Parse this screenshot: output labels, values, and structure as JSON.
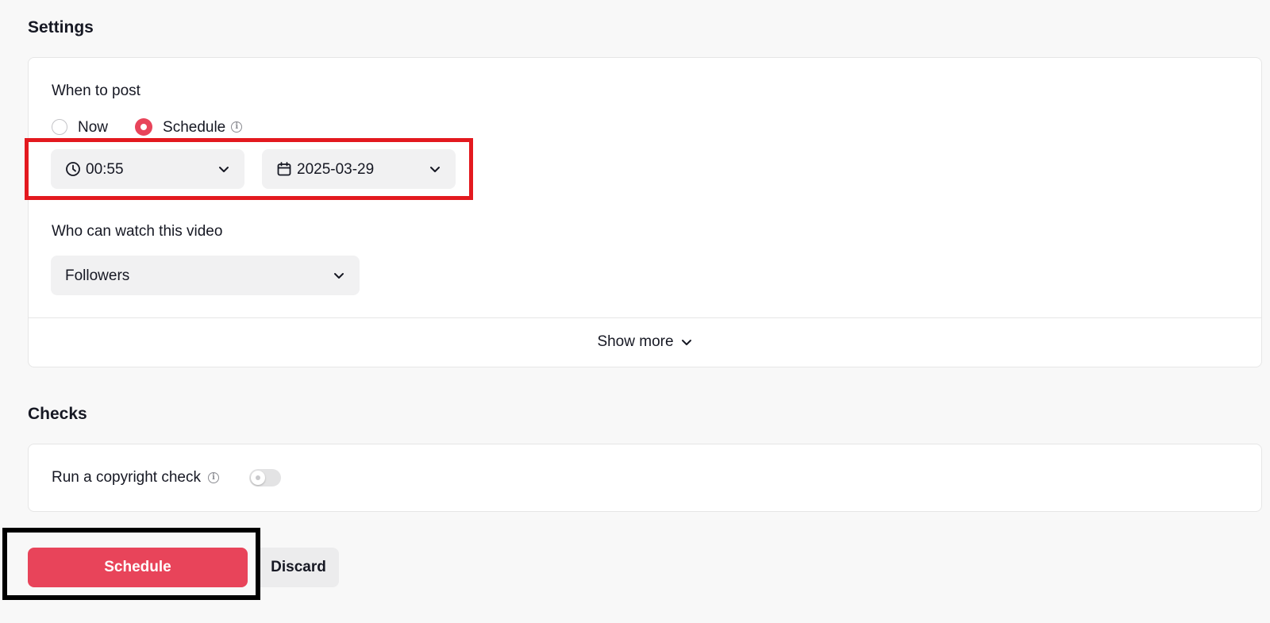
{
  "settings": {
    "title": "Settings",
    "when_to_post": {
      "label": "When to post",
      "options": [
        {
          "label": "Now",
          "checked": false
        },
        {
          "label": "Schedule",
          "checked": true
        }
      ],
      "time_value": "00:55",
      "date_value": "2025-03-29"
    },
    "visibility": {
      "label": "Who can watch this video",
      "value": "Followers"
    },
    "show_more_label": "Show more"
  },
  "checks": {
    "title": "Checks",
    "copyright_label": "Run a copyright check",
    "copyright_enabled": false
  },
  "actions": {
    "primary_label": "Schedule",
    "secondary_label": "Discard"
  },
  "colors": {
    "accent": "#e8445a",
    "highlight_red": "#e3191f",
    "highlight_black": "#000000"
  },
  "icons": {
    "time": "clock-icon",
    "date": "calendar-icon",
    "dropdown": "chevron-down-icon",
    "info": "info-icon"
  }
}
